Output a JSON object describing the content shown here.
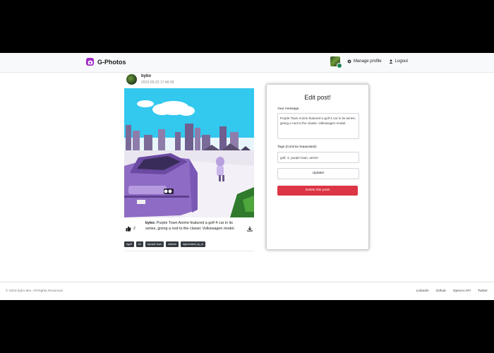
{
  "brand": {
    "name": "G-Photos"
  },
  "nav": {
    "manage_profile": "Manage profile",
    "logout": "Logout"
  },
  "post": {
    "username": "byko",
    "date": "2023-05-23 17:48:39",
    "likes": "2",
    "caption_user": "byko:",
    "caption_text": "Purple Town Anime featured a golf 4 car in its series, giving a nod to the classic Volkswagen model.",
    "tags": [
      "#golf",
      "#4",
      "#purple town",
      "#anime",
      "#generated_by_ai"
    ]
  },
  "edit": {
    "title": "Edit post!",
    "message_label": "Your message",
    "message_value": "Purple Town Anime featured a golf 4 car in its series, giving a nod to the classic Volkswagen model.",
    "tags_label": "Tags (Comma Separated):",
    "tags_value": "golf, 4, purple town, anime",
    "update_label": "Update!",
    "delete_label": "Delete this post!"
  },
  "footer": {
    "copyright": "© 2023 byko-dev. All Rights Reserved.",
    "links": [
      "Linkedin",
      "Github",
      "OpenAI API",
      "Twitter"
    ]
  },
  "colors": {
    "brand_purple": "#a128c7",
    "danger": "#dc3545",
    "tag_bg": "#343a40",
    "online": "#198754"
  }
}
